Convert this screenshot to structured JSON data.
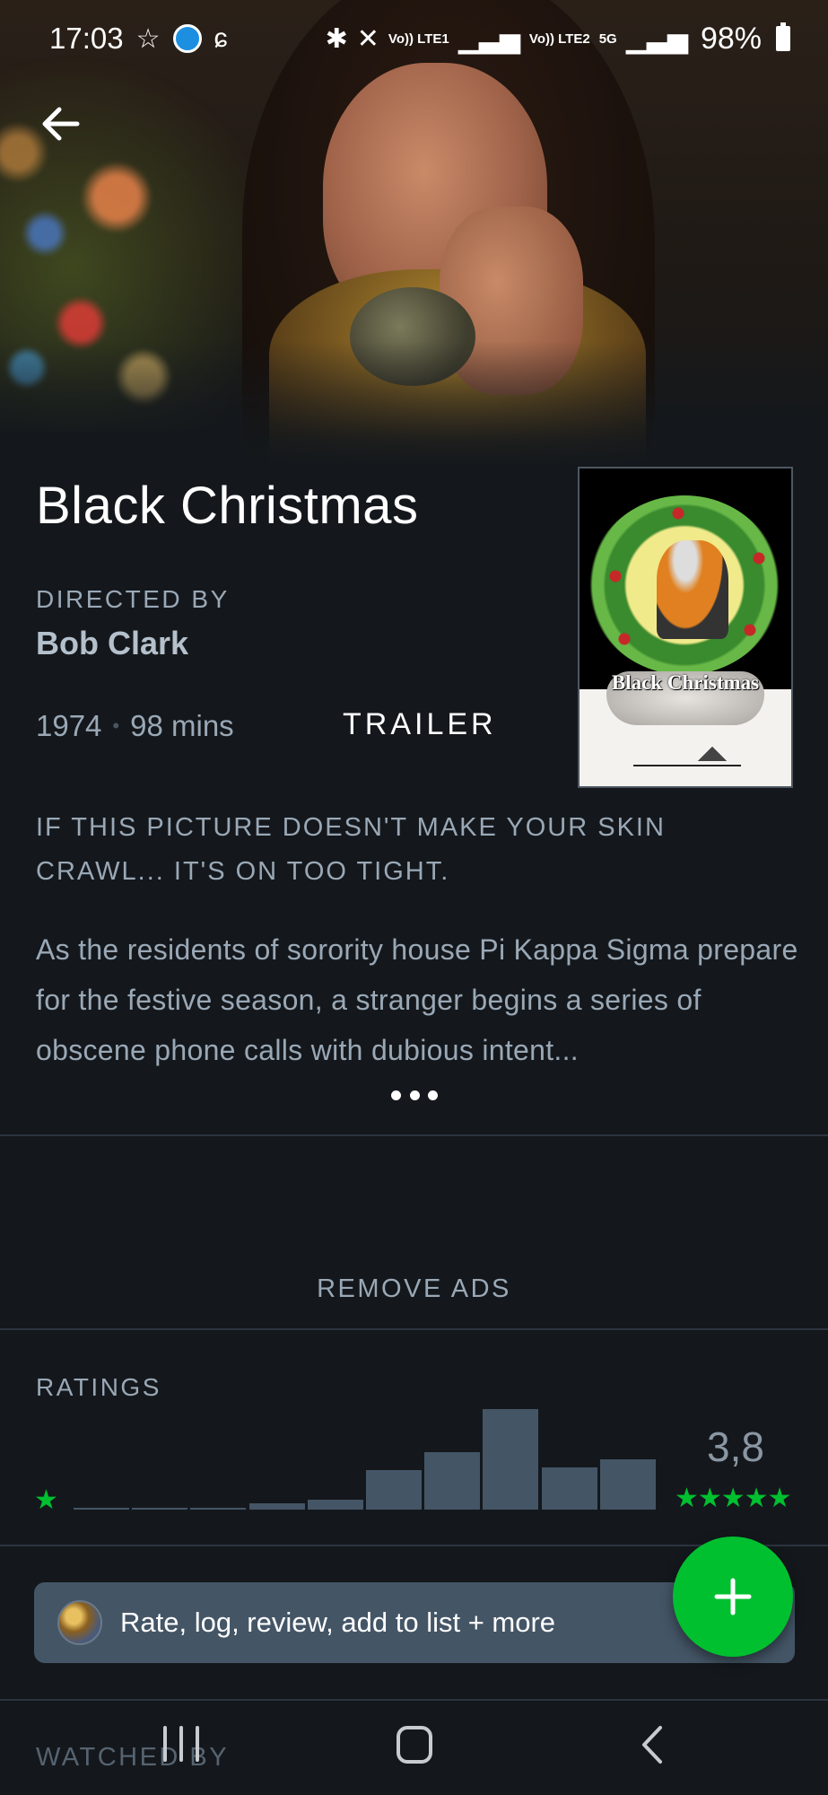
{
  "status_bar": {
    "time": "17:03",
    "battery": "98%",
    "sim1": "Vo)) LTE1",
    "sim2": "Vo)) LTE2",
    "network": "5G"
  },
  "film": {
    "title": "Black Christmas",
    "directed_by_label": "DIRECTED BY",
    "director": "Bob Clark",
    "year": "1974",
    "runtime": "98 mins",
    "trailer_label": "TRAILER",
    "tagline": "IF THIS PICTURE DOESN'T MAKE YOUR SKIN CRAWL... IT'S ON TOO TIGHT.",
    "synopsis": "As the residents of sorority house Pi Kappa Sigma prepare for the festive season, a stranger begins a series of obscene phone calls with dubious intent...",
    "poster_text": "Black Christmas"
  },
  "remove_ads_label": "REMOVE ADS",
  "ratings": {
    "label": "RATINGS",
    "average": "3,8",
    "histogram_levels": [
      0.01,
      0.01,
      0.01,
      0.06,
      0.1,
      0.39,
      0.57,
      1.0,
      0.42,
      0.5
    ],
    "low_star": "★",
    "high_stars": "★★★★★"
  },
  "action_bar": {
    "label": "Rate, log, review, add to list + more"
  },
  "fab_icon": "plus-icon",
  "watched_by_label": "WATCHED BY",
  "colors": {
    "background": "#14181c",
    "accent_green": "#00c030",
    "bar": "#445566"
  }
}
